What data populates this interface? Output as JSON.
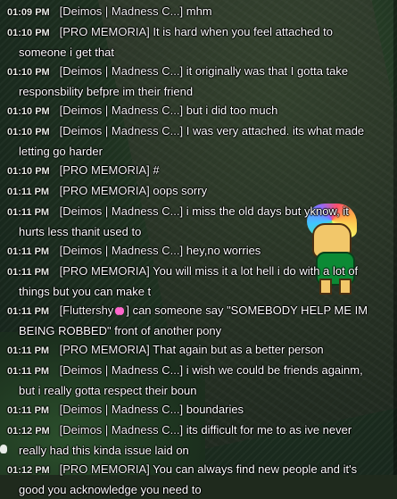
{
  "chat": {
    "lines": [
      {
        "time": "01:09 PM",
        "name": "[Deimos | Madness C...]",
        "text": "mhm",
        "cont": ""
      },
      {
        "time": "01:10 PM",
        "name": "[PRO MEMORIA]",
        "text": "It is hard when you feel attached to",
        "cont": "someone i get that"
      },
      {
        "time": "01:10 PM",
        "name": "[Deimos | Madness C...]",
        "text": "it originally was that I gotta take",
        "cont": "responsbility befpre im their friend"
      },
      {
        "time": "01:10 PM",
        "name": "[Deimos | Madness C...]",
        "text": "but i did too much",
        "cont": ""
      },
      {
        "time": "01:10 PM",
        "name": "[Deimos | Madness C...]",
        "text": "I was very attached. its what made",
        "cont": "letting go harder"
      },
      {
        "time": "01:10 PM",
        "name": "[PRO MEMORIA]",
        "text": "#",
        "cont": ""
      },
      {
        "time": "01:11 PM",
        "name": "[PRO MEMORIA]",
        "text": "oops sorry",
        "cont": ""
      },
      {
        "time": "01:11 PM",
        "name": "[Deimos | Madness C...]",
        "text": "i miss the old days but yknow, it",
        "cont": "hurts less thanit used to"
      },
      {
        "time": "01:11 PM",
        "name": "[Deimos | Madness C...]",
        "text": "hey,no worries",
        "cont": ""
      },
      {
        "time": "01:11 PM",
        "name": "[PRO MEMORIA]",
        "text": "You will miss it a lot hell i do with a lot of",
        "cont": "things but you can make t"
      },
      {
        "time": "01:11 PM",
        "name_pre": "[Fluttershy",
        "name_post": "]",
        "text": "can someone say \"SOMEBODY HELP ME IM",
        "cont": "BEING ROBBED\" front of another pony"
      },
      {
        "time": "01:11 PM",
        "name": "[PRO MEMORIA]",
        "text": "That again but as a better person",
        "cont": ""
      },
      {
        "time": "01:11 PM",
        "name": "[Deimos | Madness C...]",
        "text": "i wish we could be friends againm,",
        "cont": "but i really gotta respect their boun"
      },
      {
        "time": "01:11 PM",
        "name": "[Deimos | Madness C...]",
        "text": "boundaries",
        "cont": ""
      },
      {
        "time": "01:12 PM",
        "name": "[Deimos | Madness C...]",
        "text": "its difficult for me to as ive never",
        "cont": "really had this kinda issue laid on"
      },
      {
        "time": "01:12 PM",
        "name": "[PRO MEMORIA]",
        "text": "You can always find new people and it's",
        "cont": "good you acknowledge you need to"
      }
    ]
  },
  "icons": {
    "fluttershy_badge": "pink-bow-icon"
  },
  "colors": {
    "text": "#ffffff",
    "bow": "#ff66cc"
  }
}
